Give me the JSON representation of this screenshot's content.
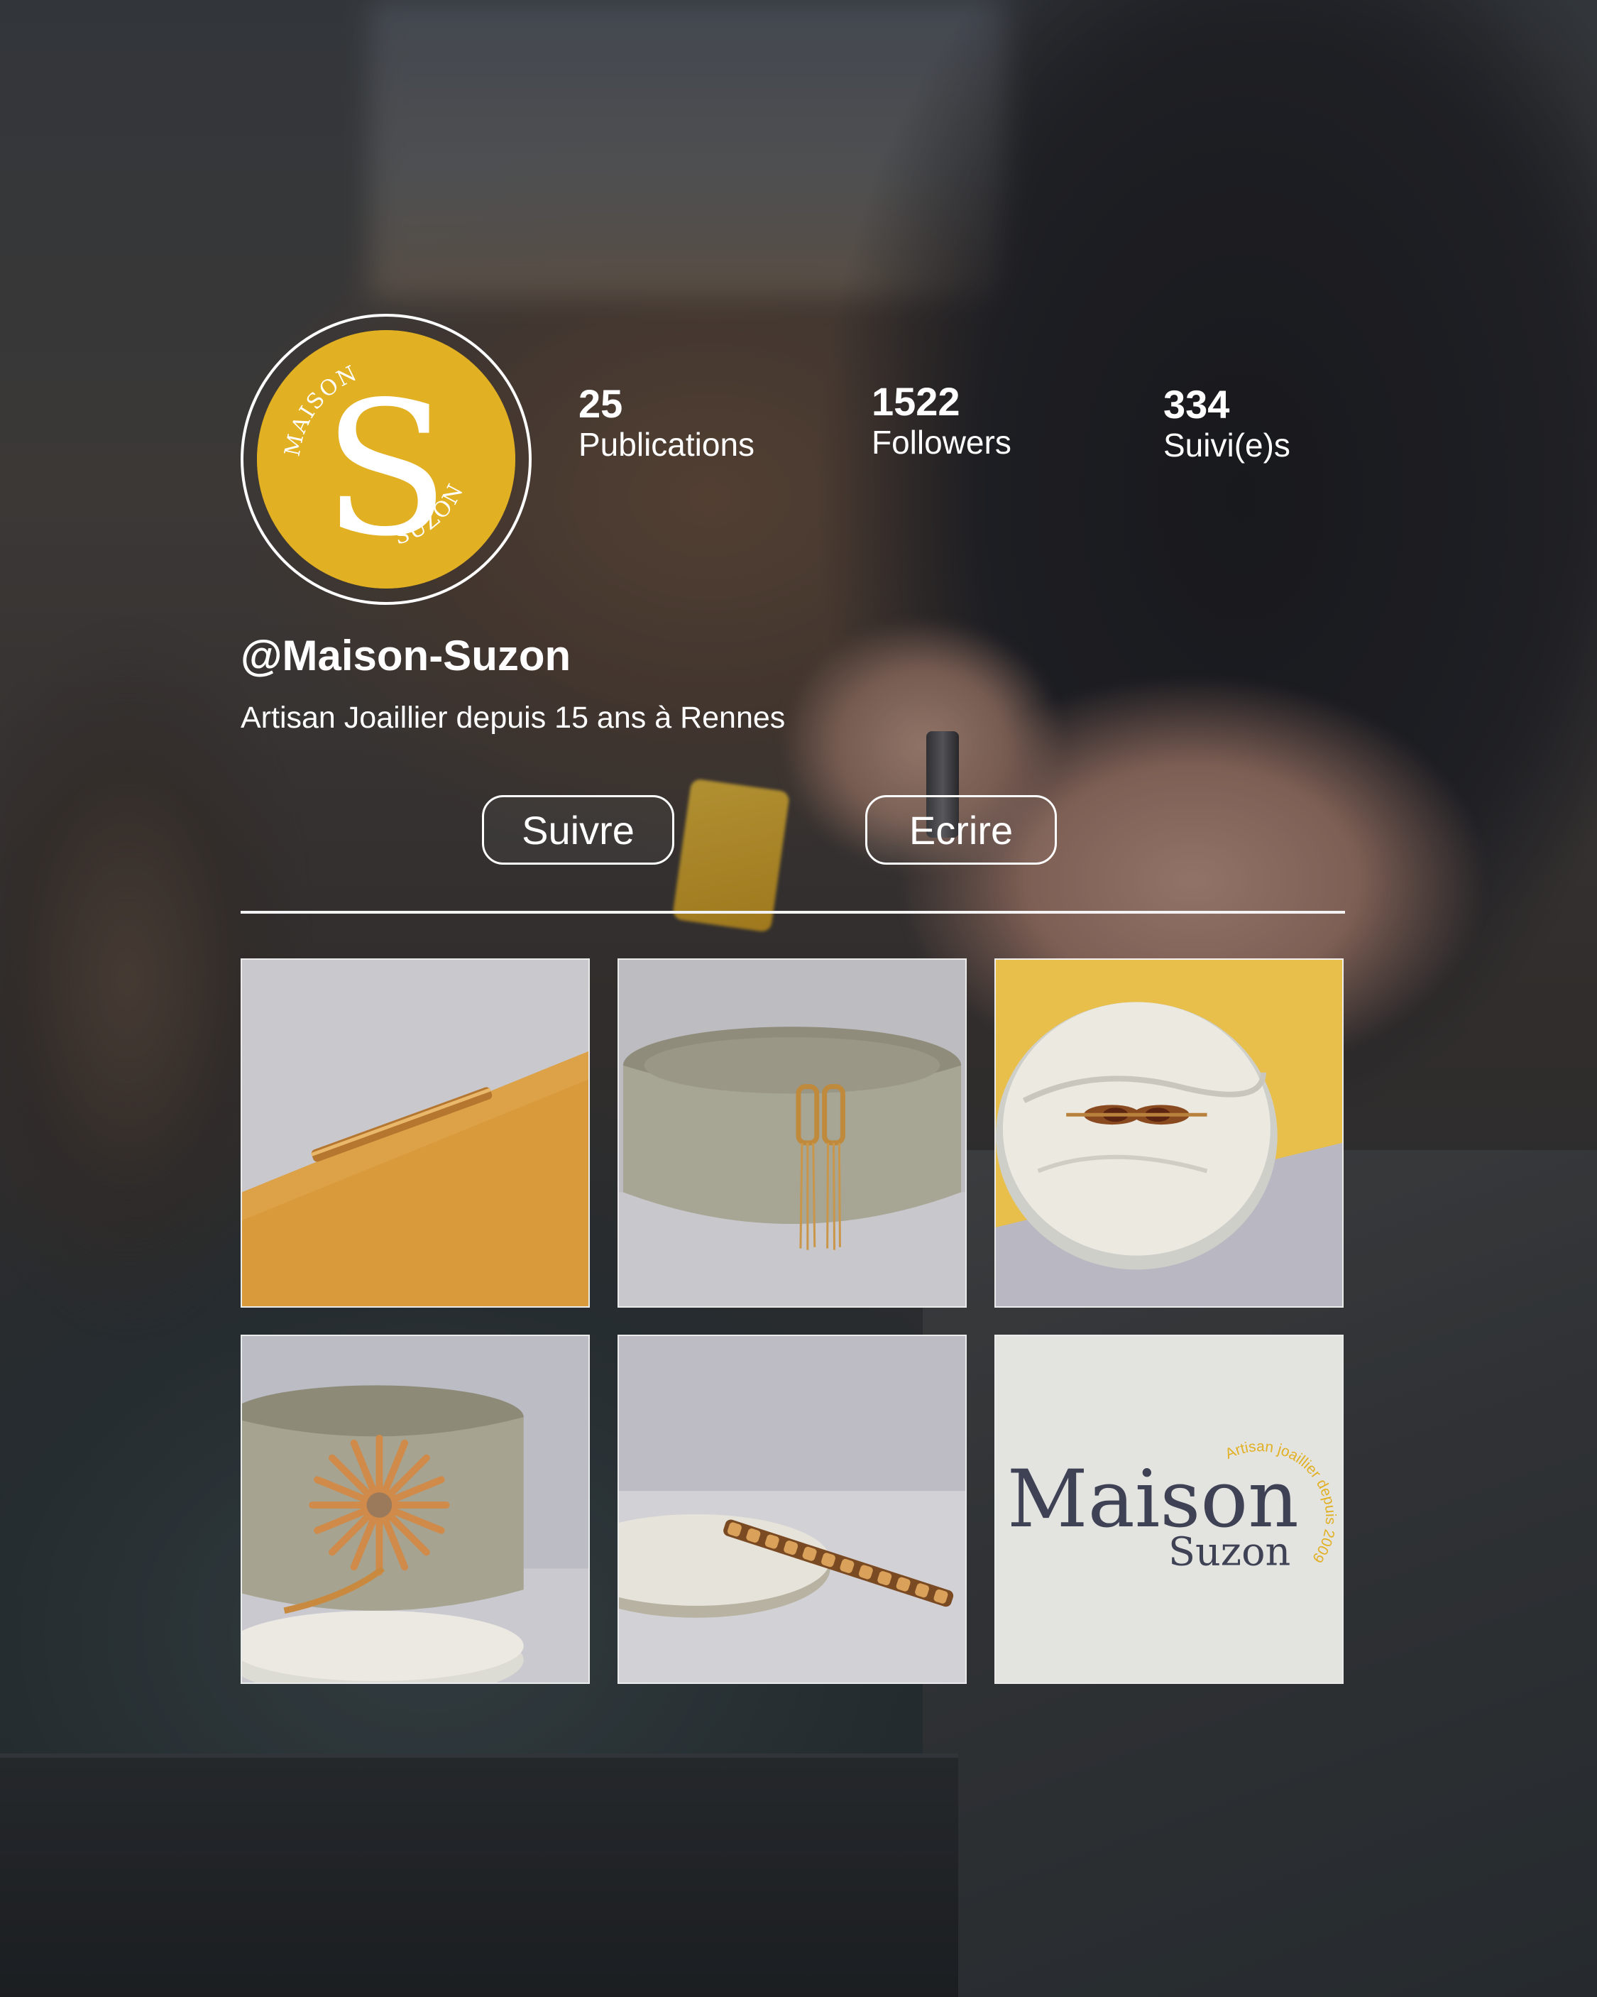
{
  "profile": {
    "handle": "@Maison-Suzon",
    "bio": "Artisan Joaillier depuis 15 ans à Rennes",
    "avatar": {
      "logo_letter": "S",
      "logo_words": [
        "MAISON",
        "SUZON"
      ],
      "color": "#e2b023"
    }
  },
  "stats": {
    "posts": {
      "value": "25",
      "label": "Publications"
    },
    "followers": {
      "value": "1522",
      "label": "Followers"
    },
    "following": {
      "value": "334",
      "label": "Suivi(e)s"
    }
  },
  "actions": {
    "follow_label": "Suivre",
    "message_label": "Ecrire"
  },
  "posts": [
    {
      "subject": "gold curb-chain bar brooch on mustard paper",
      "accent": "#d9a44a"
    },
    {
      "subject": "gold chain drop earrings on taupe ring stand",
      "accent": "#c9a064"
    },
    {
      "subject": "garnet brooch on marble coaster",
      "accent": "#e8bf4a"
    },
    {
      "subject": "gold flower brooch and ring",
      "accent": "#d99a5e"
    },
    {
      "subject": "gold curb-chain bracelet on white disc",
      "accent": "#b8864a"
    },
    {
      "subject": "Maison Suzon logo card",
      "logo_main": "Maison",
      "logo_sub": "Suzon",
      "logo_tagline": "Artisan joaillier depuis 2009",
      "accent": "#e2b023",
      "ink": "#3e4254"
    }
  ],
  "colors": {
    "text": "#ffffff",
    "brand_yellow": "#e2b023",
    "brand_ink": "#3e4254"
  }
}
